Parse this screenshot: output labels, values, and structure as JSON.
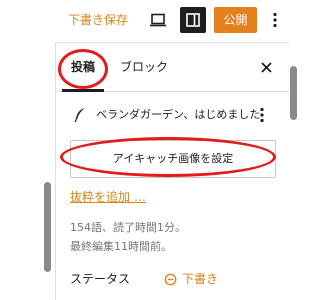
{
  "toolbar": {
    "save_draft": "下書き保存",
    "publish": "公開",
    "icons": {
      "preview": "desktop-preview-icon",
      "settings": "sidebar-toggle-icon",
      "more": "vertical-ellipsis-icon"
    }
  },
  "sidebar": {
    "tabs": [
      {
        "label": "投稿",
        "active": true
      },
      {
        "label": "ブロック",
        "active": false
      }
    ],
    "close_icon": "close-icon",
    "post": {
      "icon": "quill-icon",
      "title": "ベランダガーデン、はじめました",
      "actions_icon": "vertical-ellipsis-icon"
    },
    "featured_image_button": "アイキャッチ画像を設定",
    "excerpt_link": "抜粋を追加 …",
    "stats": {
      "words_reading": "154語、読了時間1分。",
      "last_edited": "最終編集11時間前。"
    },
    "status": {
      "label": "ステータス",
      "value": "下書き",
      "icon": "draft-status-icon"
    }
  },
  "colors": {
    "accent": "#d9861f",
    "publish_bg": "#e4801e",
    "annotation": "#e31b1b",
    "dark": "#1e1e1e",
    "muted_text": "#757575"
  }
}
